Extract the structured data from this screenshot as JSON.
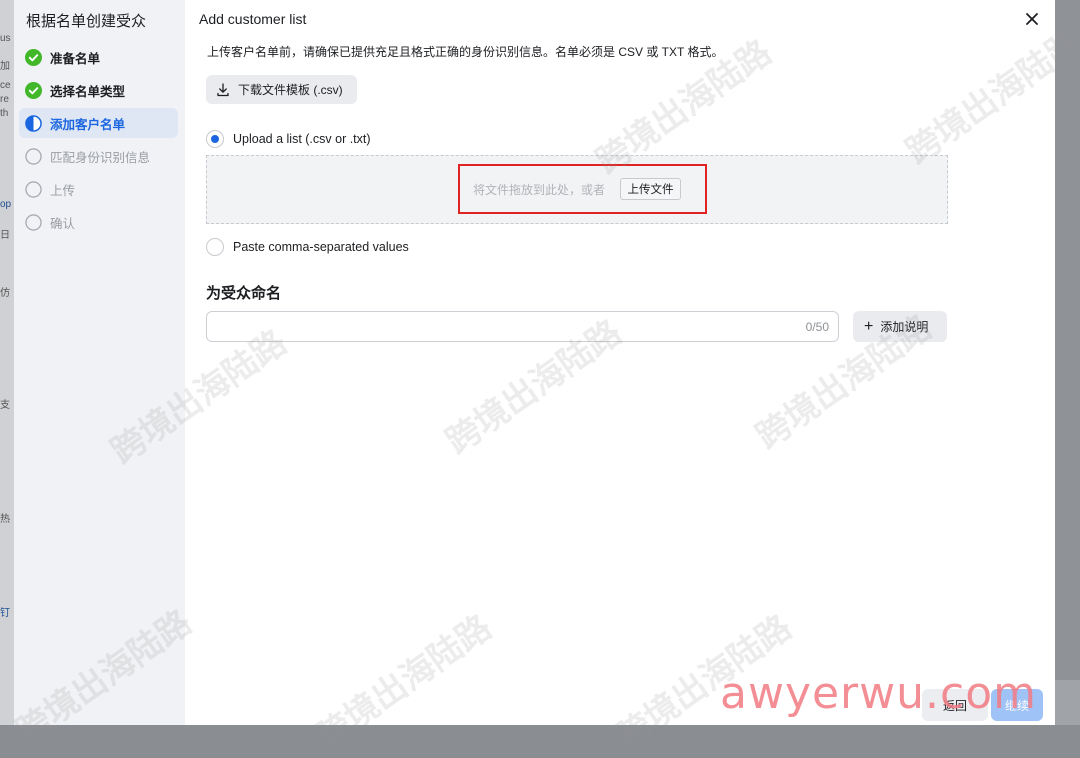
{
  "background": {
    "fragments": [
      "us",
      "加",
      "ce",
      "re",
      "th",
      "op",
      "日",
      "仿",
      "支",
      "热",
      "钉"
    ]
  },
  "sidebar": {
    "title": "根据名单创建受众",
    "steps": [
      {
        "label": "准备名单",
        "state": "done"
      },
      {
        "label": "选择名单类型",
        "state": "done"
      },
      {
        "label": "添加客户名单",
        "state": "active"
      },
      {
        "label": "匹配身份识别信息",
        "state": "todo"
      },
      {
        "label": "上传",
        "state": "todo"
      },
      {
        "label": "确认",
        "state": "todo"
      }
    ]
  },
  "dialog": {
    "title": "Add customer list",
    "description": "上传客户名单前，请确保已提供充足且格式正确的身份识别信息。名单必须是 CSV 或 TXT 格式。",
    "download_template": "下载文件模板 (.csv)",
    "option_upload": "Upload a list (.csv or .txt)",
    "option_upload_selected": true,
    "dropzone_text": "将文件拖放到此处，或者",
    "upload_button": "上传文件",
    "option_paste": "Paste comma-separated values",
    "name_section_title": "为受众命名",
    "name_value": "",
    "name_counter": "0/50",
    "add_description": "添加说明",
    "back_button": "返回",
    "next_button": "继续"
  },
  "watermarks": {
    "text": "跨境出海陆路",
    "site": "awyerwu.com"
  },
  "colors": {
    "accent": "#1b66e0",
    "done_green": "#42b72a",
    "highlight_red": "#e02424",
    "next_disabled": "#9fc2f7"
  }
}
